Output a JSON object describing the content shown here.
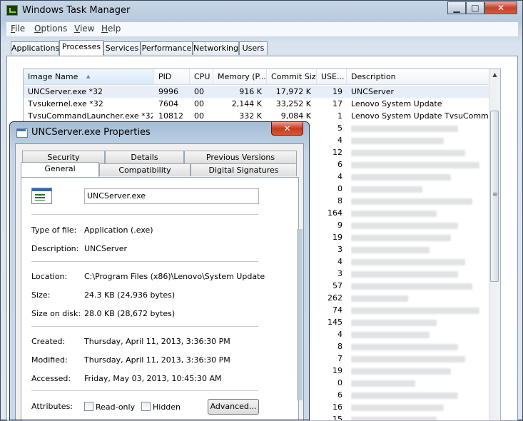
{
  "window": {
    "title": "Windows Task Manager",
    "controls": {
      "minimize": "▁",
      "maximize": "□",
      "close": "✕"
    }
  },
  "menu": [
    {
      "label": "File",
      "mnemonic": "F",
      "rest": "ile"
    },
    {
      "label": "Options",
      "mnemonic": "O",
      "rest": "ptions"
    },
    {
      "label": "View",
      "mnemonic": "V",
      "rest": "iew"
    },
    {
      "label": "Help",
      "mnemonic": "H",
      "rest": "elp"
    }
  ],
  "tabs": [
    "Applications",
    "Processes",
    "Services",
    "Performance",
    "Networking",
    "Users"
  ],
  "active_tab": "Processes",
  "process_list": {
    "columns": [
      "Image Name",
      "PID",
      "CPU",
      "Memory (P...",
      "Commit Size",
      "USE...",
      "Description"
    ],
    "sorted_column": "Image Name",
    "rows": [
      {
        "name": "UNCServer.exe *32",
        "pid": "9996",
        "cpu": "00",
        "memory": "916 K",
        "commit": "17,972 K",
        "user": "19",
        "description": "UNCServer",
        "selected": true
      },
      {
        "name": "Tvsukernel.exe *32",
        "pid": "7604",
        "cpu": "00",
        "memory": "2,144 K",
        "commit": "33,252 K",
        "user": "17",
        "description": "Lenovo System Update"
      },
      {
        "name": "TvsuCommandLauncher.exe *32",
        "pid": "10812",
        "cpu": "00",
        "memory": "332 K",
        "commit": "9,084 K",
        "user": "1",
        "description": "Lenovo System Update TvsuCommandLa"
      }
    ],
    "obscured_user_values": [
      "5",
      "4",
      "12",
      "6",
      "4",
      "0",
      "8",
      "164",
      "9",
      "19",
      "3",
      "4",
      "3",
      "57",
      "262",
      "74",
      "145",
      "4",
      "8",
      "7",
      "19",
      "0",
      "6",
      "16",
      "15"
    ]
  },
  "properties_dialog": {
    "title": "UNCServer.exe Properties",
    "close": "✕",
    "tabs_row1": [
      "Security",
      "Details",
      "Previous Versions"
    ],
    "tabs_row2": [
      "General",
      "Compatibility",
      "Digital Signatures"
    ],
    "active_tab": "General",
    "file_name": "UNCServer.exe",
    "fields": {
      "type_label": "Type of file:",
      "type_value": "Application (.exe)",
      "desc_label": "Description:",
      "desc_value": "UNCServer",
      "location_label": "Location:",
      "location_value": "C:\\Program Files (x86)\\Lenovo\\System Update",
      "size_label": "Size:",
      "size_value": "24.3 KB (24,936 bytes)",
      "sizeondisk_label": "Size on disk:",
      "sizeondisk_value": "28.0 KB (28,672 bytes)",
      "created_label": "Created:",
      "created_value": "Thursday, April 11, 2013, 3:36:30 PM",
      "modified_label": "Modified:",
      "modified_value": "Thursday, April 11, 2013, 3:36:30 PM",
      "accessed_label": "Accessed:",
      "accessed_value": "Friday, May 03, 2013, 10:45:30 AM",
      "attributes_label": "Attributes:"
    },
    "readonly_label": "Read-only",
    "hidden_label": "Hidden",
    "advanced_button": "Advanced..."
  }
}
